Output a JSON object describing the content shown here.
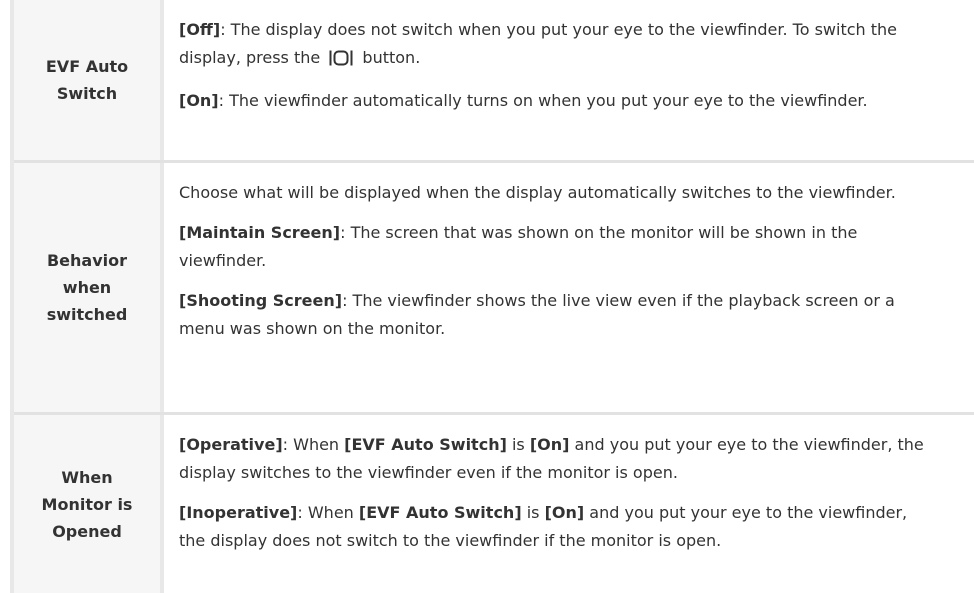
{
  "rows": [
    {
      "label": "EVF Auto Switch",
      "paragraphs": [
        {
          "b1": "[Off]",
          "t1": ": The display does not switch when you put your eye to the viewfinder. To switch the display, press the",
          "icon": "lcd-viewfinder-button-icon",
          "t2": "button."
        },
        {
          "b1": "[On]",
          "t1": ": The viewfinder automatically turns on when you put your eye to the viewfinder."
        }
      ]
    },
    {
      "label": "Behavior when switched",
      "paragraphs": [
        {
          "t1": "Choose what will be displayed when the display automatically switches to the viewfinder."
        },
        {
          "b1": "[Maintain Screen]",
          "t1": ": The screen that was shown on the monitor will be shown in the viewfinder."
        },
        {
          "b1": "[Shooting Screen]",
          "t1": ": The viewfinder shows the live view even if the playback screen or a menu was shown on the monitor."
        }
      ]
    },
    {
      "label": "When Monitor is Opened",
      "paragraphs": [
        {
          "b1": "[Operative]",
          "t1": ": When ",
          "b2": "[EVF Auto Switch]",
          "t2": " is ",
          "b3": "[On]",
          "t3": " and you put your eye to the viewfinder, the display switches to the viewfinder even if the monitor is open."
        },
        {
          "b1": "[Inoperative]",
          "t1": ": When ",
          "b2": "[EVF Auto Switch]",
          "t2": " is ",
          "b3": "[On]",
          "t3": " and you put your eye to the viewfinder, the display does not switch to the viewfinder if the monitor is open."
        }
      ]
    }
  ]
}
